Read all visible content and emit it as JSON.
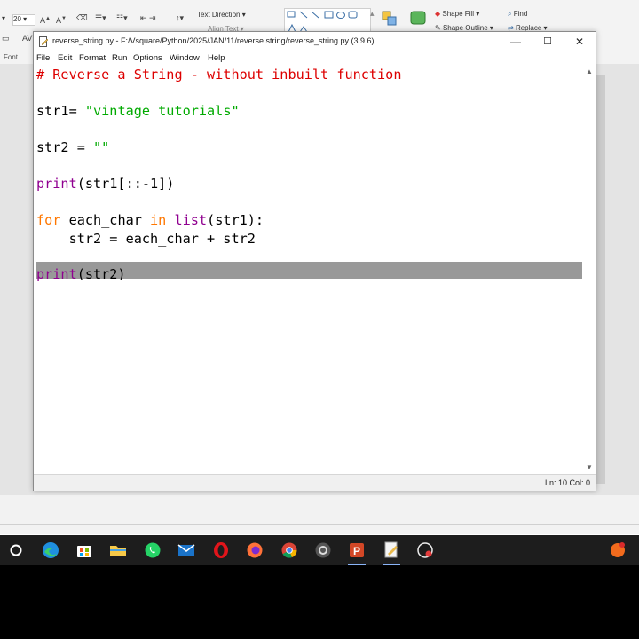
{
  "ribbon": {
    "font_size": "20",
    "font_group_label": "Font",
    "text_direction": "Text Direction",
    "align_text": "Align Text",
    "shape_fill": "Shape Fill",
    "shape_outline": "Shape Outline",
    "find": "Find",
    "replace": "Replace"
  },
  "window": {
    "title": "reverse_string.py - F:/Vsquare/Python/2025/JAN/11/reverse string/reverse_string.py (3.9.6)",
    "minimize": "—",
    "maximize": "☐",
    "close": "✕"
  },
  "menu": [
    "File",
    "Edit",
    "Format",
    "Run",
    "Options",
    "Window",
    "Help"
  ],
  "code": {
    "line1": "# Reverse a String - without inbuilt function",
    "line3_a": "str1= ",
    "line3_b": "\"vintage tutorials\"",
    "line5_a": "str2 = ",
    "line5_b": "\"\"",
    "line7_a": "print",
    "line7_b": "(str1[::-1])",
    "line9_a": "for",
    "line9_b": " each_char ",
    "line9_c": "in",
    "line9_d": " ",
    "line9_e": "list",
    "line9_f": "(str1):",
    "line10": "    str2 = each_char + str2",
    "line12_a": "print",
    "line12_b": "(str2)"
  },
  "status": {
    "position": "Ln: 10   Col: 0"
  },
  "colors": {
    "keyword": "#ff7700",
    "builtin": "#900090",
    "comment": "#dd0000",
    "string": "#00aa00",
    "selection": "#999999"
  },
  "taskbar": {
    "icons": [
      "search-icon",
      "edge-icon",
      "store-icon",
      "file-explorer-icon",
      "whatsapp-icon",
      "mail-icon",
      "opera-icon",
      "firefox-icon",
      "chrome-icon",
      "settings-app-icon",
      "powerpoint-icon",
      "idle-editor-icon",
      "recorder-icon",
      "notification-icon"
    ]
  }
}
